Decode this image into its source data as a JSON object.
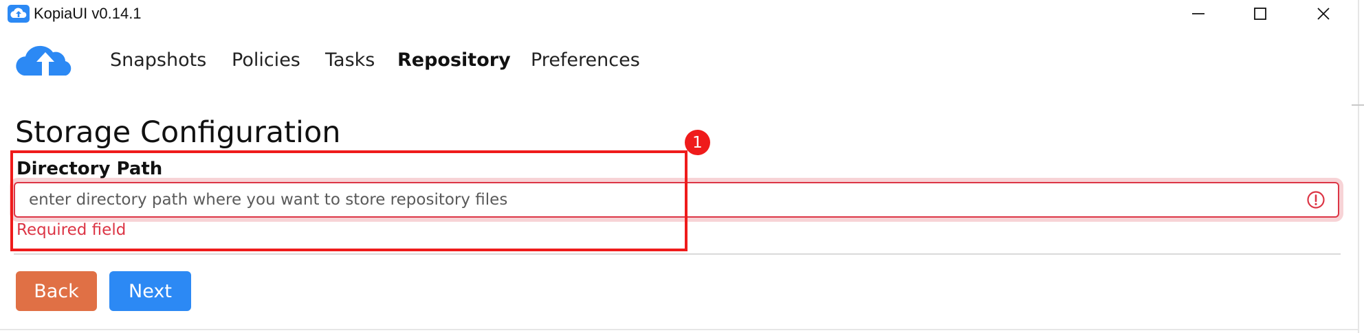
{
  "window": {
    "title": "KopiaUI v0.14.1",
    "icon": "cloud-upload-icon",
    "controls": {
      "minimize": "minimize-icon",
      "maximize": "maximize-icon",
      "close": "close-icon"
    }
  },
  "nav": {
    "logo": "cloud-upload-logo",
    "items": [
      {
        "label": "Snapshots",
        "active": false
      },
      {
        "label": "Policies",
        "active": false
      },
      {
        "label": "Tasks",
        "active": false
      },
      {
        "label": "Repository",
        "active": true
      },
      {
        "label": "Preferences",
        "active": false
      }
    ]
  },
  "page": {
    "heading": "Storage Configuration",
    "field": {
      "label": "Directory Path",
      "value": "",
      "placeholder": "enter directory path where you want to store repository files",
      "error": "Required field",
      "error_icon": "exclamation-circle-icon"
    },
    "annotation": {
      "marker": "1"
    },
    "buttons": {
      "back": "Back",
      "next": "Next"
    }
  },
  "colors": {
    "brand": "#2c89f4",
    "back_button": "#e07045",
    "next_button": "#2c89f4",
    "error": "#dc3545",
    "annotation": "#ef1b1b"
  }
}
